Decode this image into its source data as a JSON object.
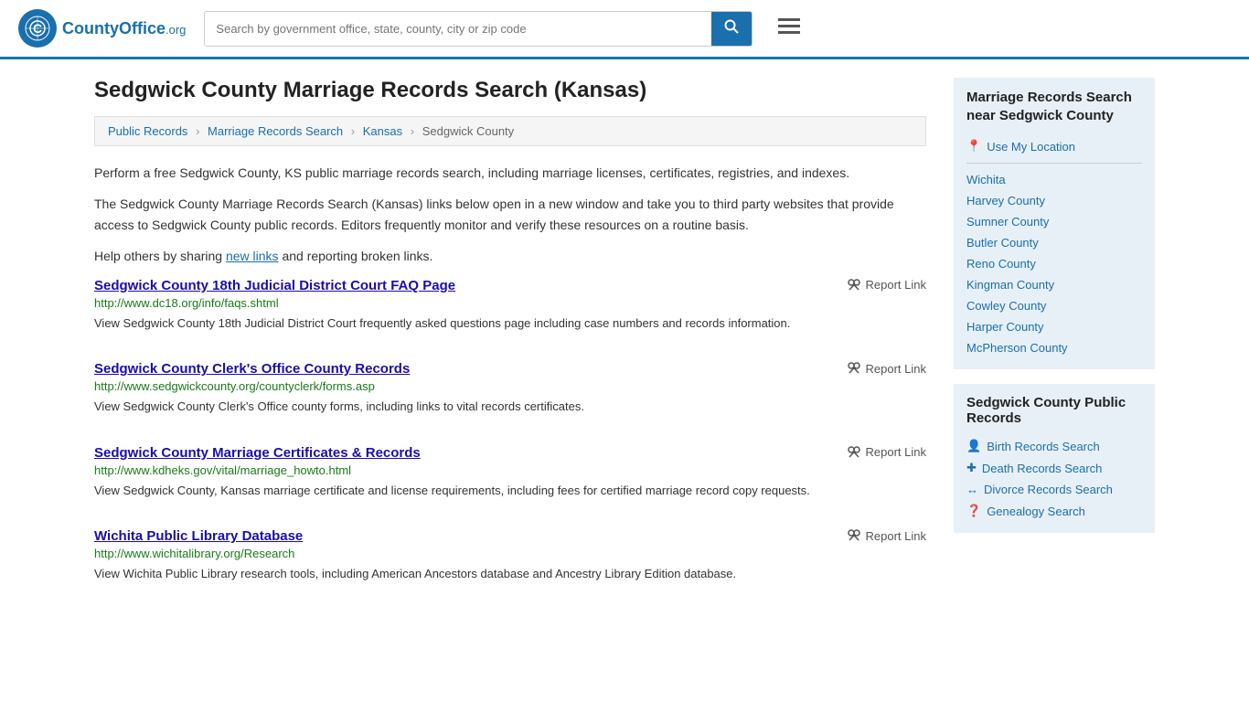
{
  "header": {
    "logo_text": "CountyOffice",
    "logo_org": ".org",
    "search_placeholder": "Search by government office, state, county, city or zip code"
  },
  "page": {
    "title": "Sedgwick County Marriage Records Search (Kansas)"
  },
  "breadcrumb": {
    "items": [
      {
        "label": "Public Records",
        "url": "#"
      },
      {
        "label": "Marriage Records Search",
        "url": "#"
      },
      {
        "label": "Kansas",
        "url": "#"
      },
      {
        "label": "Sedgwick County",
        "url": "#"
      }
    ]
  },
  "description": {
    "para1": "Perform a free Sedgwick County, KS public marriage records search, including marriage licenses, certificates, registries, and indexes.",
    "para2": "The Sedgwick County Marriage Records Search (Kansas) links below open in a new window and take you to third party websites that provide access to Sedgwick County public records. Editors frequently monitor and verify these resources on a routine basis.",
    "para3_prefix": "Help others by sharing ",
    "para3_link": "new links",
    "para3_suffix": " and reporting broken links."
  },
  "records": [
    {
      "title": "Sedgwick County 18th Judicial District Court FAQ Page",
      "url": "http://www.dc18.org/info/faqs.shtml",
      "desc": "View Sedgwick County 18th Judicial District Court frequently asked questions page including case numbers and records information.",
      "report": "Report Link"
    },
    {
      "title": "Sedgwick County Clerk's Office County Records",
      "url": "http://www.sedgwickcounty.org/countyclerk/forms.asp",
      "desc": "View Sedgwick County Clerk's Office county forms, including links to vital records certificates.",
      "report": "Report Link"
    },
    {
      "title": "Sedgwick County Marriage Certificates & Records",
      "url": "http://www.kdheks.gov/vital/marriage_howto.html",
      "desc": "View Sedgwick County, Kansas marriage certificate and license requirements, including fees for certified marriage record copy requests.",
      "report": "Report Link"
    },
    {
      "title": "Wichita Public Library Database",
      "url": "http://www.wichitalibrary.org/Research",
      "desc": "View Wichita Public Library research tools, including American Ancestors database and Ancestry Library Edition database.",
      "report": "Report Link"
    }
  ],
  "sidebar": {
    "nearby_title": "Marriage Records Search near Sedgwick County",
    "use_location": "Use My Location",
    "nearby_links": [
      {
        "label": "Wichita"
      },
      {
        "label": "Harvey County"
      },
      {
        "label": "Sumner County"
      },
      {
        "label": "Butler County"
      },
      {
        "label": "Reno County"
      },
      {
        "label": "Kingman County"
      },
      {
        "label": "Cowley County"
      },
      {
        "label": "Harper County"
      },
      {
        "label": "McPherson County"
      }
    ],
    "public_records_title": "Sedgwick County Public Records",
    "public_records_links": [
      {
        "label": "Birth Records Search",
        "icon": "person"
      },
      {
        "label": "Death Records Search",
        "icon": "cross"
      },
      {
        "label": "Divorce Records Search",
        "icon": "arrows"
      },
      {
        "label": "Genealogy Search",
        "icon": "question"
      }
    ]
  }
}
